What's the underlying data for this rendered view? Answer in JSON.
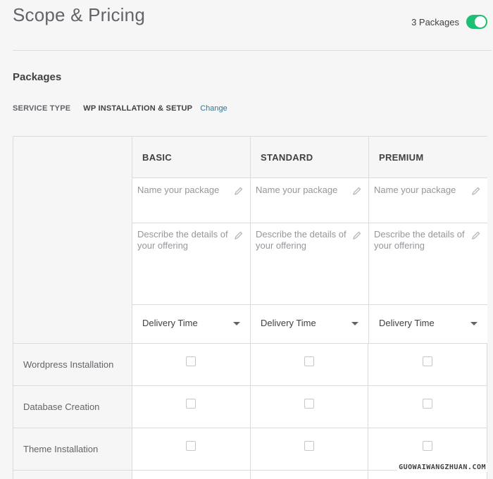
{
  "header": {
    "title": "Scope & Pricing",
    "packages_toggle_label": "3 Packages",
    "packages_toggle_on": true
  },
  "section": {
    "title": "Packages"
  },
  "service_type": {
    "label": "SERVICE TYPE",
    "value": "WP INSTALLATION & SETUP",
    "change_label": "Change"
  },
  "packages": [
    {
      "tier": "BASIC",
      "name_placeholder": "Name your package",
      "description_placeholder": "Describe the details of your offering",
      "delivery_label": "Delivery Time"
    },
    {
      "tier": "STANDARD",
      "name_placeholder": "Name your package",
      "description_placeholder": "Describe the details of your offering",
      "delivery_label": "Delivery Time"
    },
    {
      "tier": "PREMIUM",
      "name_placeholder": "Name your package",
      "description_placeholder": "Describe the details of your offering",
      "delivery_label": "Delivery Time"
    }
  ],
  "features": [
    {
      "label": "Wordpress Installation",
      "checked": [
        false,
        false,
        false
      ]
    },
    {
      "label": "Database Creation",
      "checked": [
        false,
        false,
        false
      ]
    },
    {
      "label": "Theme Installation",
      "checked": [
        false,
        false,
        false
      ]
    }
  ],
  "watermark": "GUOWAIWANGZHUAN.COM",
  "colors": {
    "accent_green": "#1dbf73",
    "link_blue": "#1f7aa5"
  },
  "icons": {
    "edit": "pencil-icon",
    "dropdown": "caret-down-icon"
  }
}
